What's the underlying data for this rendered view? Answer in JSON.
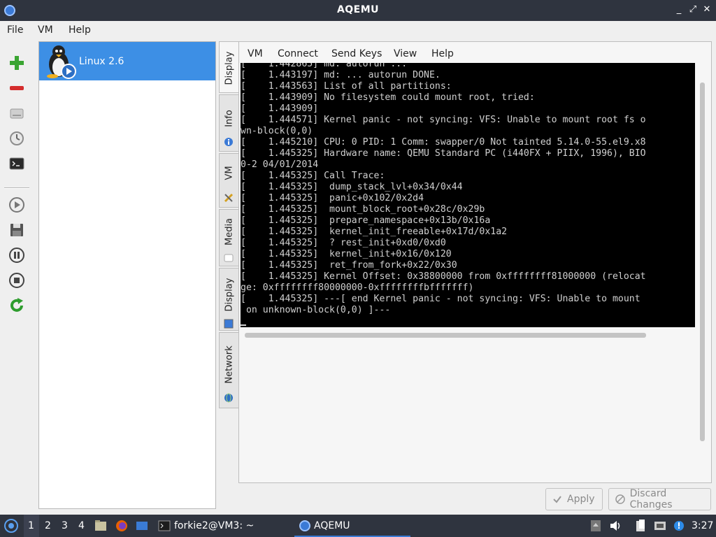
{
  "window": {
    "title": "AQEMU",
    "controls": [
      "_",
      "⤢",
      "✕"
    ]
  },
  "menubar": {
    "items": [
      "File",
      "VM",
      "Help"
    ]
  },
  "toolbar": {
    "buttons": [
      "add-vm",
      "remove-vm",
      "storage",
      "timer",
      "terminal",
      "start",
      "save",
      "pause",
      "stop",
      "reset"
    ]
  },
  "vm_list": {
    "items": [
      {
        "label": "Linux 2.6",
        "selected": true
      }
    ]
  },
  "side_tabs": [
    {
      "label": "Display",
      "active": true
    },
    {
      "label": "Info"
    },
    {
      "label": "VM"
    },
    {
      "label": "Media"
    },
    {
      "label": "Display"
    },
    {
      "label": "Network"
    }
  ],
  "vnc_menu": {
    "items": [
      "VM",
      "Connect",
      "Send Keys",
      "View",
      "Help"
    ]
  },
  "console": {
    "lines": [
      "[    1.442865] md: autorun ...",
      "[    1.443197] md: ... autorun DONE.",
      "[    1.443563] List of all partitions:",
      "[    1.443909] No filesystem could mount root, tried:",
      "[    1.443909]",
      "[    1.444571] Kernel panic - not syncing: VFS: Unable to mount root fs o",
      "wn-block(0,0)",
      "[    1.445210] CPU: 0 PID: 1 Comm: swapper/0 Not tainted 5.14.0-55.el9.x8",
      "[    1.445325] Hardware name: QEMU Standard PC (i440FX + PIIX, 1996), BIO",
      "0-2 04/01/2014",
      "[    1.445325] Call Trace:",
      "[    1.445325]  dump_stack_lvl+0x34/0x44",
      "[    1.445325]  panic+0x102/0x2d4",
      "[    1.445325]  mount_block_root+0x28c/0x29b",
      "[    1.445325]  prepare_namespace+0x13b/0x16a",
      "[    1.445325]  kernel_init_freeable+0x17d/0x1a2",
      "[    1.445325]  ? rest_init+0xd0/0xd0",
      "[    1.445325]  kernel_init+0x16/0x120",
      "[    1.445325]  ret_from_fork+0x22/0x30",
      "[    1.445325] Kernel Offset: 0x38800000 from 0xffffffff81000000 (relocat",
      "ge: 0xffffffff80000000-0xffffffffbfffffff)",
      "[    1.445325] ---[ end Kernel panic - not syncing: VFS: Unable to mount",
      " on unknown-block(0,0) ]---"
    ]
  },
  "buttons": {
    "apply": "Apply",
    "discard": "Discard Changes"
  },
  "taskbar": {
    "workspaces": [
      "1",
      "2",
      "3",
      "4"
    ],
    "tasks": [
      {
        "label": "forkie2@VM3: ~",
        "icon": "terminal-icon"
      },
      {
        "label": "AQEMU",
        "icon": "aqemu-icon",
        "active": true
      }
    ],
    "clock": "3:27"
  },
  "colors": {
    "selection": "#3d8fe5",
    "titlebar": "#2f343f",
    "console_bg": "#000000"
  }
}
